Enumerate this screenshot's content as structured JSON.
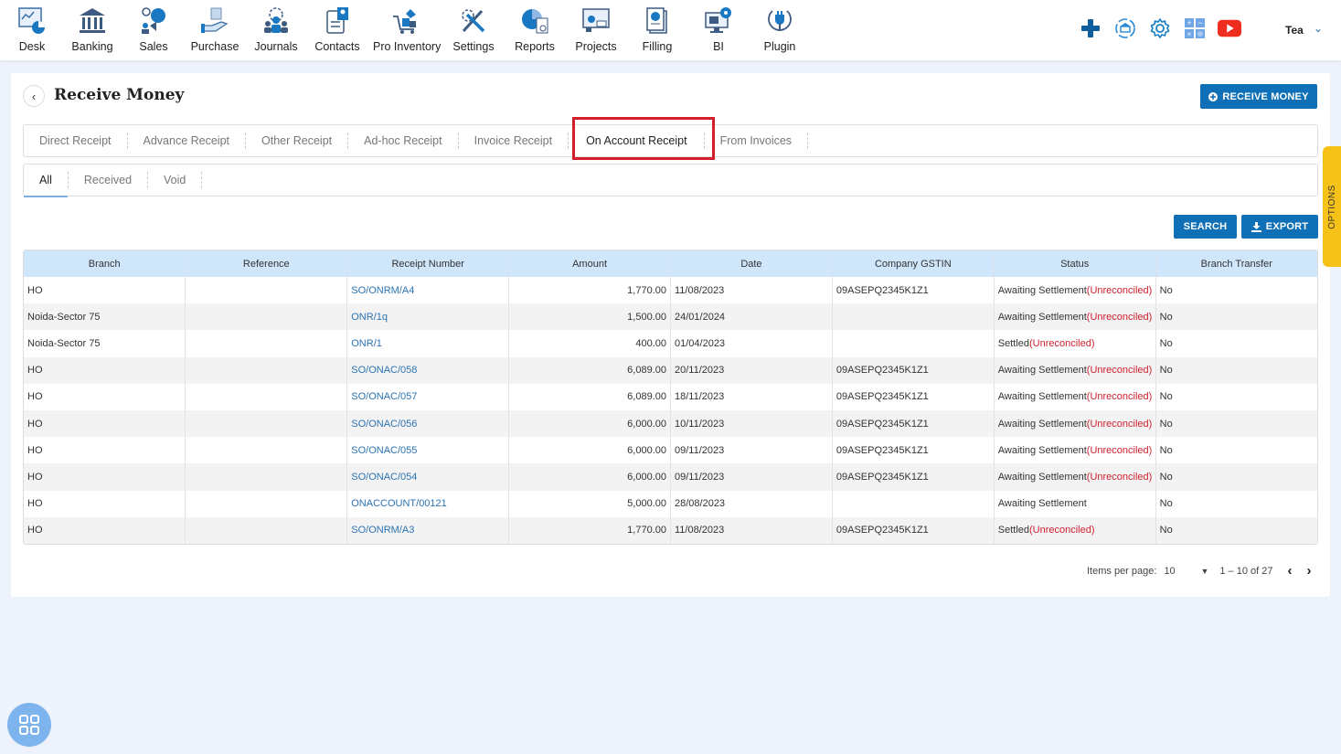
{
  "nav": {
    "items": [
      {
        "label": "Desk",
        "icon": "desk-icon"
      },
      {
        "label": "Banking",
        "icon": "bank-icon"
      },
      {
        "label": "Sales",
        "icon": "sales-icon"
      },
      {
        "label": "Purchase",
        "icon": "purchase-icon"
      },
      {
        "label": "Journals",
        "icon": "journals-icon"
      },
      {
        "label": "Contacts",
        "icon": "contacts-icon"
      },
      {
        "label": "Pro Inventory",
        "icon": "inventory-icon"
      },
      {
        "label": "Settings",
        "icon": "settings-tools-icon"
      },
      {
        "label": "Reports",
        "icon": "reports-icon"
      },
      {
        "label": "Projects",
        "icon": "projects-icon"
      },
      {
        "label": "Filling",
        "icon": "filing-icon"
      },
      {
        "label": "BI",
        "icon": "bi-icon"
      },
      {
        "label": "Plugin",
        "icon": "plugin-icon"
      }
    ],
    "user": "Tea"
  },
  "page": {
    "title": "Receive Money",
    "receive_button": "RECEIVE MONEY",
    "search_button": "SEARCH",
    "export_button": "EXPORT",
    "options_label": "OPTIONS"
  },
  "tabs": [
    {
      "label": "Direct Receipt",
      "active": false
    },
    {
      "label": "Advance Receipt",
      "active": false
    },
    {
      "label": "Other Receipt",
      "active": false
    },
    {
      "label": "Ad-hoc Receipt",
      "active": false
    },
    {
      "label": "Invoice Receipt",
      "active": false
    },
    {
      "label": "On Account Receipt",
      "active": true
    },
    {
      "label": "From Invoices",
      "active": false
    }
  ],
  "subtabs": [
    {
      "label": "All",
      "active": true
    },
    {
      "label": "Received",
      "active": false
    },
    {
      "label": "Void",
      "active": false
    }
  ],
  "table": {
    "columns": [
      "Branch",
      "Reference",
      "Receipt Number",
      "Amount",
      "Date",
      "Company GSTIN",
      "Status",
      "Branch Transfer"
    ],
    "rows": [
      {
        "branch": "HO",
        "reference": "",
        "receipt": "SO/ONRM/A4",
        "amount": "1,770.00",
        "date": "11/08/2023",
        "gstin": "09ASEPQ2345K1Z1",
        "status": "Awaiting Settlement",
        "recon": "(Unreconciled)",
        "transfer": "No"
      },
      {
        "branch": "Noida-Sector 75",
        "reference": "",
        "receipt": "ONR/1q",
        "amount": "1,500.00",
        "date": "24/01/2024",
        "gstin": "",
        "status": "Awaiting Settlement",
        "recon": "(Unreconciled)",
        "transfer": "No"
      },
      {
        "branch": "Noida-Sector 75",
        "reference": "",
        "receipt": "ONR/1",
        "amount": "400.00",
        "date": "01/04/2023",
        "gstin": "",
        "status": "Settled",
        "recon": "(Unreconciled)",
        "transfer": "No"
      },
      {
        "branch": "HO",
        "reference": "",
        "receipt": "SO/ONAC/058",
        "amount": "6,089.00",
        "date": "20/11/2023",
        "gstin": "09ASEPQ2345K1Z1",
        "status": "Awaiting Settlement",
        "recon": "(Unreconciled)",
        "transfer": "No"
      },
      {
        "branch": "HO",
        "reference": "",
        "receipt": "SO/ONAC/057",
        "amount": "6,089.00",
        "date": "18/11/2023",
        "gstin": "09ASEPQ2345K1Z1",
        "status": "Awaiting Settlement",
        "recon": "(Unreconciled)",
        "transfer": "No"
      },
      {
        "branch": "HO",
        "reference": "",
        "receipt": "SO/ONAC/056",
        "amount": "6,000.00",
        "date": "10/11/2023",
        "gstin": "09ASEPQ2345K1Z1",
        "status": "Awaiting Settlement",
        "recon": "(Unreconciled)",
        "transfer": "No"
      },
      {
        "branch": "HO",
        "reference": "",
        "receipt": "SO/ONAC/055",
        "amount": "6,000.00",
        "date": "09/11/2023",
        "gstin": "09ASEPQ2345K1Z1",
        "status": "Awaiting Settlement",
        "recon": "(Unreconciled)",
        "transfer": "No"
      },
      {
        "branch": "HO",
        "reference": "",
        "receipt": "SO/ONAC/054",
        "amount": "6,000.00",
        "date": "09/11/2023",
        "gstin": "09ASEPQ2345K1Z1",
        "status": "Awaiting Settlement",
        "recon": "(Unreconciled)",
        "transfer": "No"
      },
      {
        "branch": "HO",
        "reference": "",
        "receipt": "ONACCOUNT/00121",
        "amount": "5,000.00",
        "date": "28/08/2023",
        "gstin": "",
        "status": "Awaiting Settlement",
        "recon": "",
        "transfer": "No"
      },
      {
        "branch": "HO",
        "reference": "",
        "receipt": "SO/ONRM/A3",
        "amount": "1,770.00",
        "date": "11/08/2023",
        "gstin": "09ASEPQ2345K1Z1",
        "status": "Settled",
        "recon": "(Unreconciled)",
        "transfer": "No"
      }
    ]
  },
  "pagination": {
    "items_per_page_label": "Items per page:",
    "items_per_page": "10",
    "range": "1 – 10 of 27"
  },
  "colors": {
    "primary": "#0f70b7",
    "header_bg": "#cfe6fb",
    "link": "#2a73b3",
    "unreconciled": "#d0202e",
    "highlight_box": "#d21f2b",
    "options_tab": "#f6c21a"
  }
}
